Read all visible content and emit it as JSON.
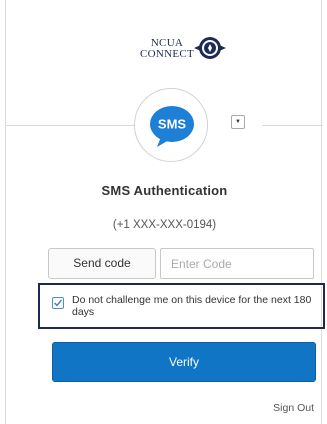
{
  "logo": {
    "line1": "NCUA",
    "line2": "CONNECT"
  },
  "factor": {
    "icon_text": "SMS",
    "icon": "sms-bubble-icon",
    "dropdown_icon": "caret-down-icon",
    "accent": "#1e7fd6"
  },
  "title": "SMS Authentication",
  "phone": "(+1 XXX-XXX-0194)",
  "send_code_label": "Send code",
  "code_input": {
    "placeholder": "Enter Code",
    "value": ""
  },
  "remember": {
    "label": "Do not challenge me on this device for the next 180 days",
    "checked": true
  },
  "verify_label": "Verify",
  "sign_out_label": "Sign Out",
  "colors": {
    "primary": "#0f75c4",
    "highlight_border": "#1d2a4f"
  }
}
